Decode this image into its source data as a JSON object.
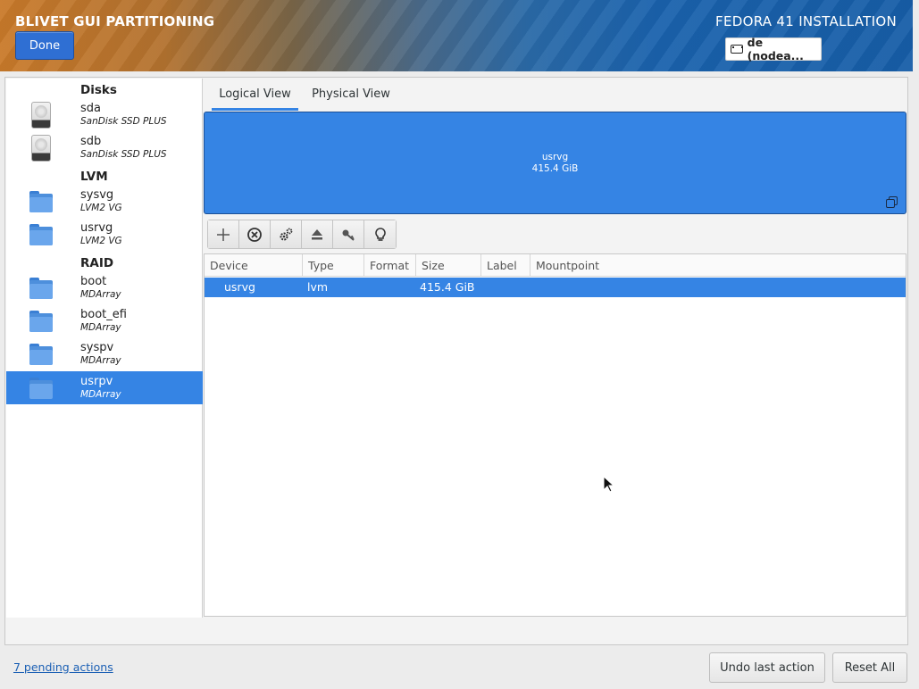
{
  "header": {
    "app_title": "BLIVET GUI PARTITIONING",
    "done_label": "Done",
    "install_title": "FEDORA 41 INSTALLATION",
    "keyboard_layout": "de (nodea..."
  },
  "sidebar": {
    "groups": {
      "disks": "Disks",
      "lvm": "LVM",
      "raid": "RAID"
    },
    "disks": [
      {
        "name": "sda",
        "sub": "SanDisk SSD PLUS"
      },
      {
        "name": "sdb",
        "sub": "SanDisk SSD PLUS"
      }
    ],
    "lvm": [
      {
        "name": "sysvg",
        "sub": "LVM2 VG"
      },
      {
        "name": "usrvg",
        "sub": "LVM2 VG"
      }
    ],
    "raid": [
      {
        "name": "boot",
        "sub": "MDArray"
      },
      {
        "name": "boot_efi",
        "sub": "MDArray"
      },
      {
        "name": "syspv",
        "sub": "MDArray"
      },
      {
        "name": "usrpv",
        "sub": "MDArray",
        "selected": true
      }
    ]
  },
  "tabs": [
    {
      "label": "Logical View",
      "active": true
    },
    {
      "label": "Physical View",
      "active": false
    }
  ],
  "visual": {
    "name": "usrvg",
    "size": "415.4 GiB",
    "color": "#3584e4"
  },
  "toolbar": [
    "add-icon",
    "delete-icon",
    "edit-icon",
    "unmount-icon",
    "decrypt-key-icon",
    "info-bulb-icon"
  ],
  "table": {
    "columns": [
      "Device",
      "Type",
      "Format",
      "Size",
      "Label",
      "Mountpoint"
    ],
    "rows": [
      {
        "device": "usrvg",
        "type": "lvm",
        "format": "",
        "size": "415.4 GiB",
        "label": "",
        "mountpoint": ""
      }
    ]
  },
  "footer": {
    "pending": "7 pending actions",
    "undo_label": "Undo last action",
    "reset_label": "Reset All"
  }
}
